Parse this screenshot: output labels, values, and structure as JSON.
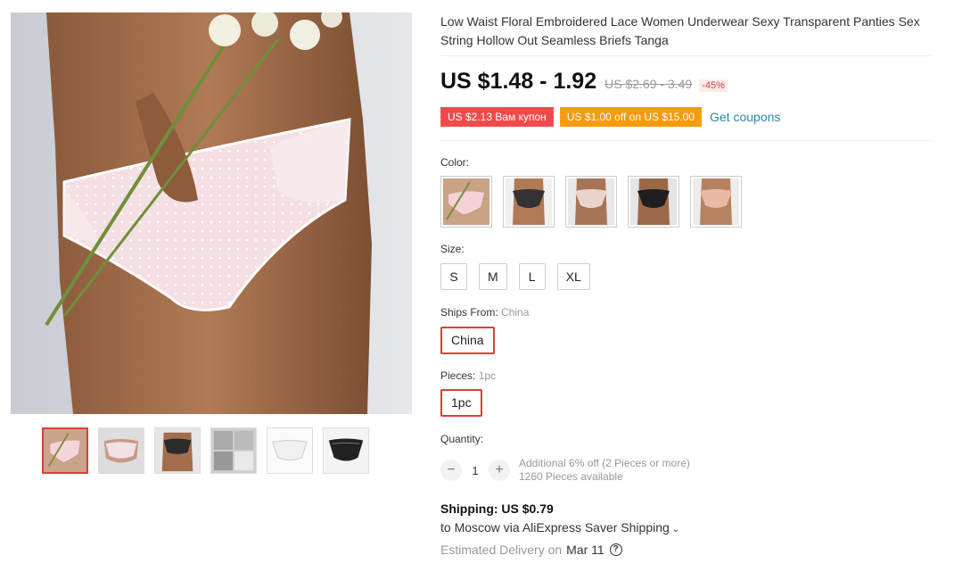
{
  "product": {
    "title": "Low Waist Floral Embroidered Lace Women Underwear Sexy Transparent Panties Sex String Hollow Out Seamless Briefs Tanga",
    "price_current": "US $1.48 - 1.92",
    "price_original": "US $2.69 - 3.49",
    "discount": "-45%"
  },
  "coupons": {
    "coupon_red": "US $2.13 Вам купон",
    "coupon_orange": "US $1.00 off on US $15.00",
    "get_coupons": "Get coupons"
  },
  "gallery": {
    "thumbnail_count": 6,
    "selected_index": 0
  },
  "options": {
    "color_label": "Color:",
    "size_label": "Size:",
    "sizes": [
      "S",
      "M",
      "L",
      "XL"
    ],
    "ships_from_label": "Ships From:",
    "ships_from_value": "China",
    "ships_from_selected": "China",
    "pieces_label": "Pieces:",
    "pieces_value": "1pc",
    "pieces_selected": "1pc"
  },
  "quantity": {
    "label": "Quantity:",
    "minus": "−",
    "value": "1",
    "plus": "+",
    "note_discount": "Additional 6% off (2 Pieces or more)",
    "note_available": "1260 Pieces available"
  },
  "shipping": {
    "title": "Shipping: US $0.79",
    "destination": "to Moscow via AliExpress Saver Shipping",
    "chevron": "⌄",
    "delivery_label": "Estimated Delivery on",
    "delivery_date": "Mar 11",
    "help_glyph": "?"
  },
  "colors": {
    "accent_red": "#e03c3c",
    "coupon_red": "#f24a4a",
    "coupon_orange": "#f79a0c",
    "link_blue": "#2b87a6"
  }
}
